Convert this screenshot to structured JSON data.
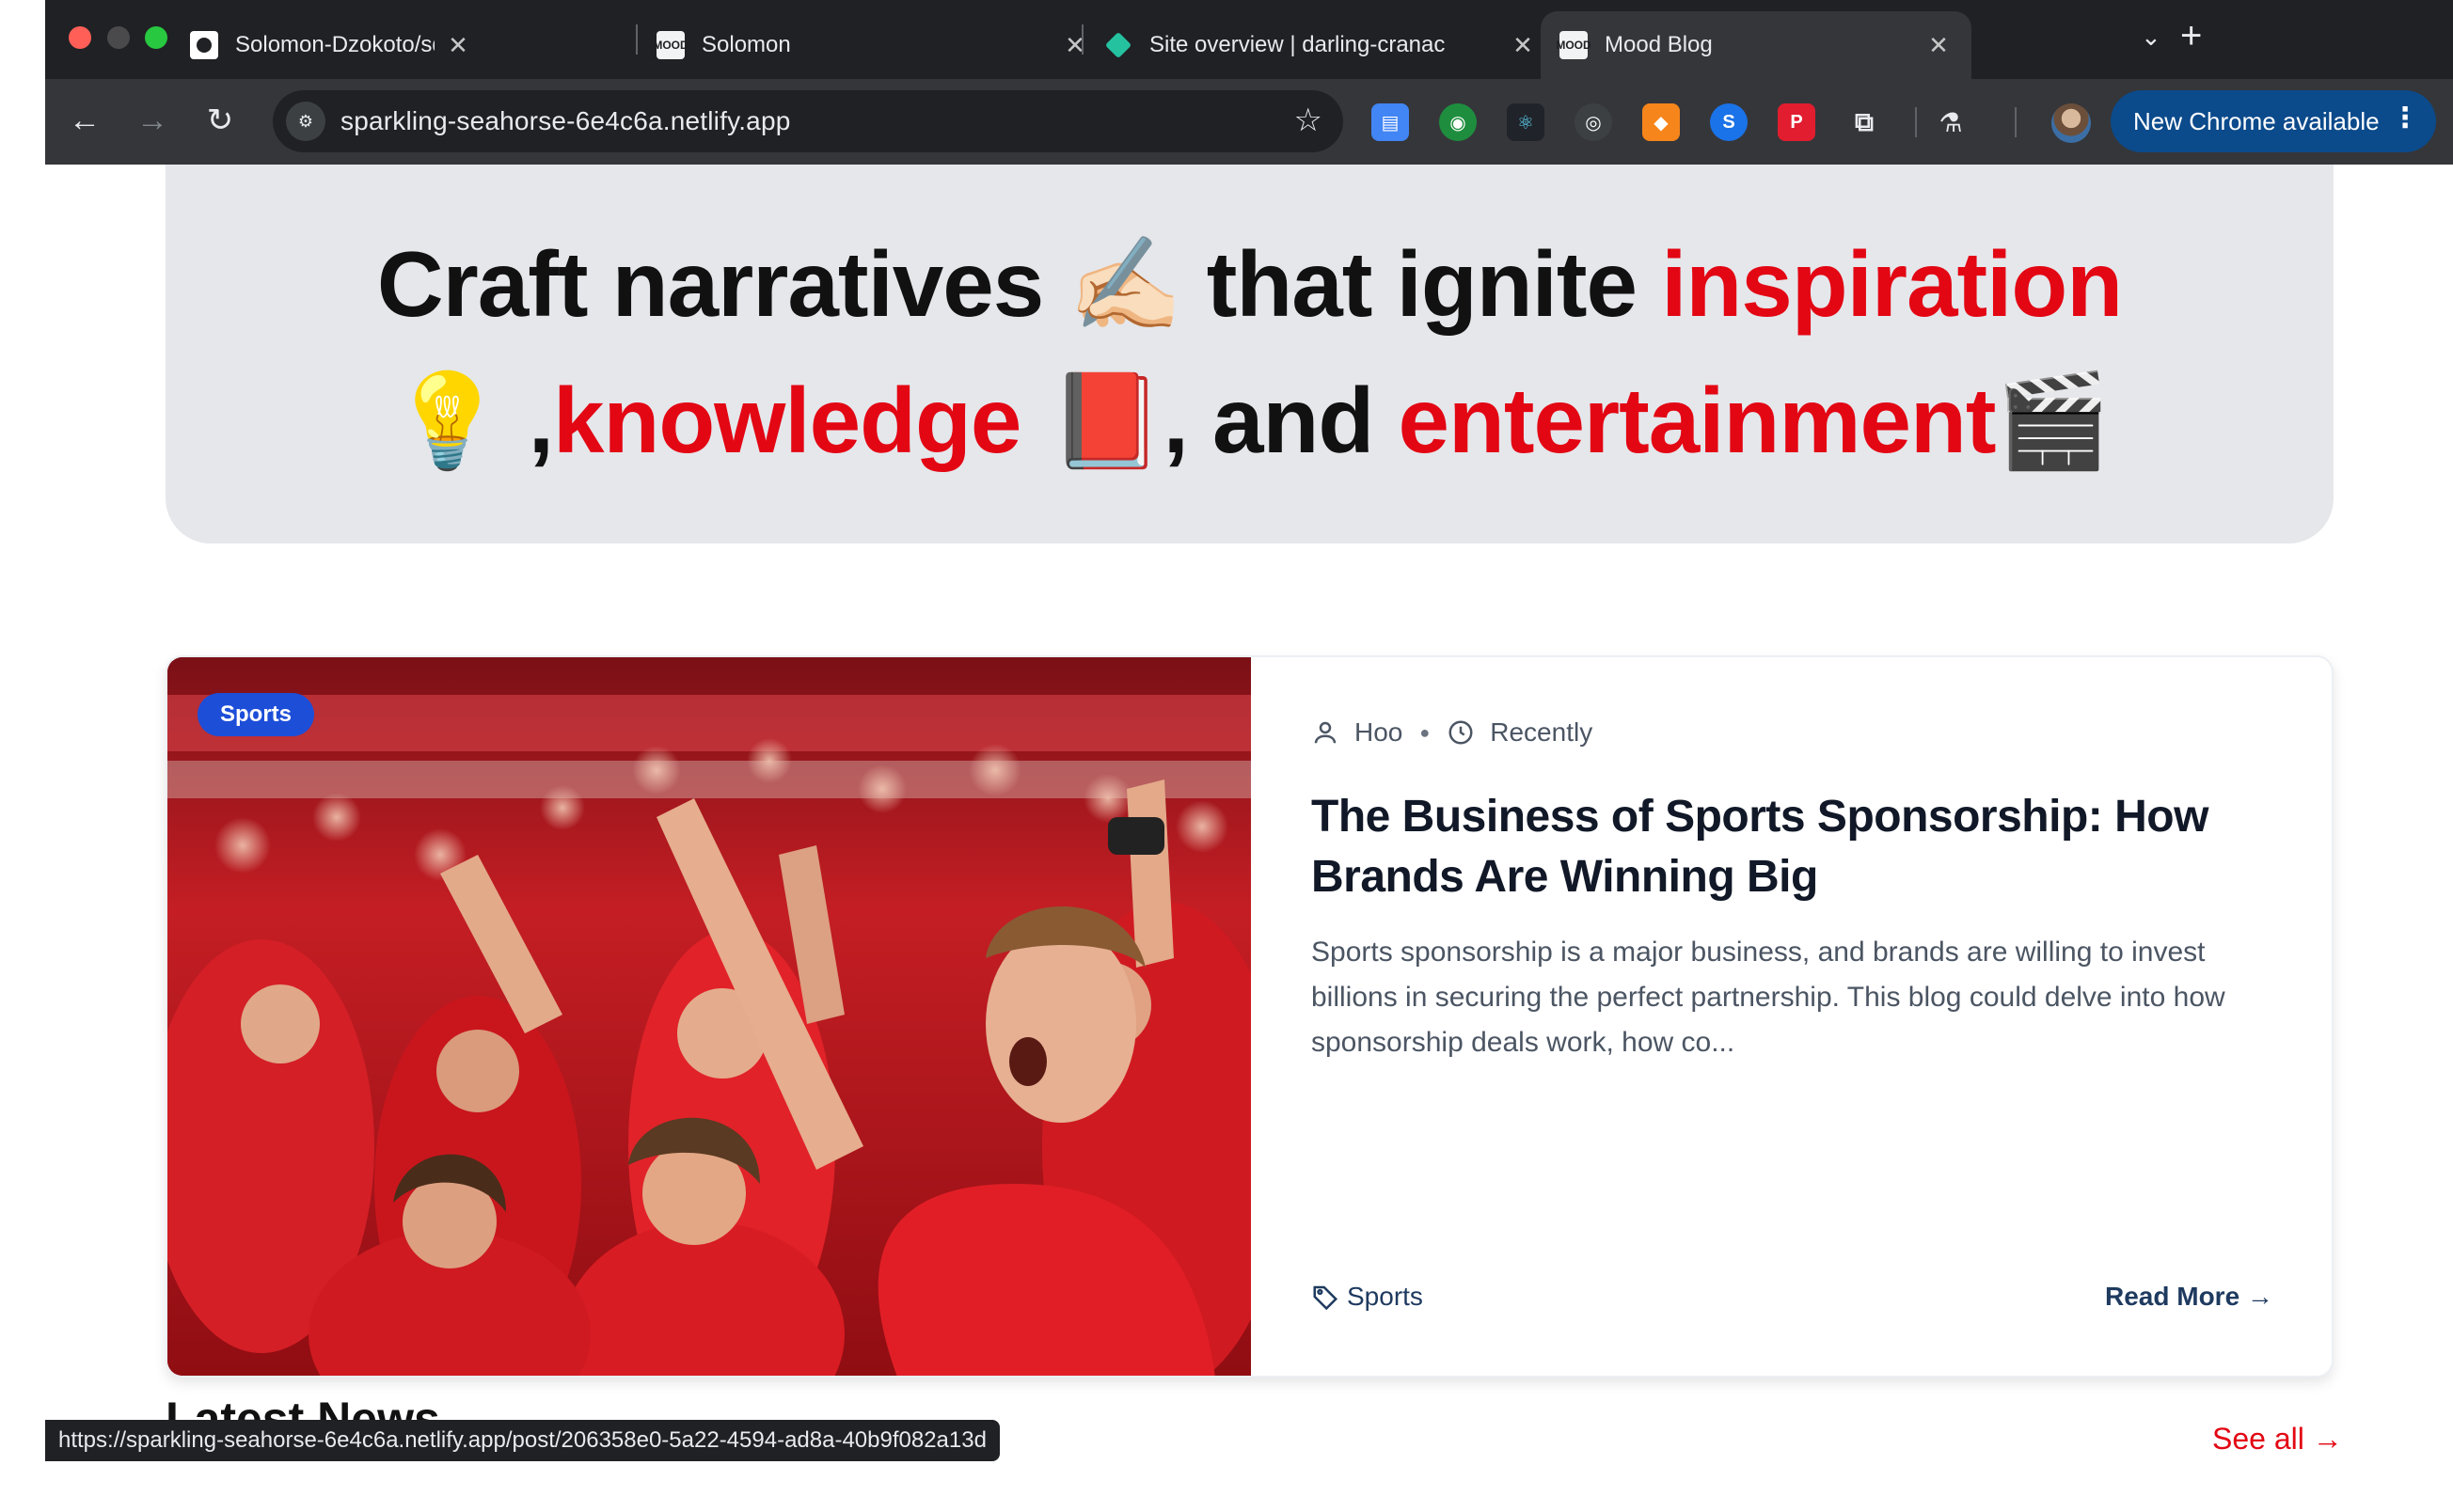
{
  "browser": {
    "tabs": [
      {
        "title": "Solomon-Dzokoto/sd-mls-glo",
        "favicon": "github-icon",
        "active": false
      },
      {
        "title": "Solomon",
        "favicon": "mood-blog-icon",
        "active": false
      },
      {
        "title": "Site overview | darling-cranac",
        "favicon": "netlify-icon",
        "active": false
      },
      {
        "title": "Mood Blog",
        "favicon": "mood-blog-icon",
        "active": true
      }
    ],
    "tab_close": "✕",
    "tab_search_icon": "chevron-down-icon",
    "new_tab_icon": "plus-icon",
    "url": "sparkling-seahorse-6e4c6a.netlify.app",
    "update_button": "New Chrome available",
    "status_url": "https://sparkling-seahorse-6e4c6a.netlify.app/post/206358e0-5a22-4594-ad8a-40b9f082a13d",
    "colors": {
      "frame": "#202124",
      "toolbar": "#35363a",
      "update": "#0b4a8b"
    }
  },
  "hero": {
    "line1": {
      "a": "Craft narratives ",
      "emoji1": "✍🏻",
      "b": " that ignite ",
      "c": "inspiration"
    },
    "line2": {
      "emoji1": "💡",
      "a": " ,",
      "b": "knowledge",
      "emoji2": " 📕",
      "c": ", and ",
      "d": "entertainment",
      "emoji3": "🎬"
    },
    "accent_color": "#e30613",
    "background": "#e5e7eb"
  },
  "featured_post": {
    "category": "Sports",
    "author": "Hoo",
    "date": "Recently",
    "title": "The Business of Sports Sponsorship: How Brands Are Winning Big",
    "excerpt": "Sports sponsorship is a major business, and brands are willing to invest billions in securing the perfect partnership. This blog could delve into how sponsorship deals work, how co...",
    "tag": "Sports",
    "read_more": "Read More →",
    "image_subject": "cheering-fans-in-red-stadium",
    "chip_color": "#1d4ed8"
  },
  "latest_news": {
    "title": "Latest News",
    "see_all": "See all →"
  }
}
